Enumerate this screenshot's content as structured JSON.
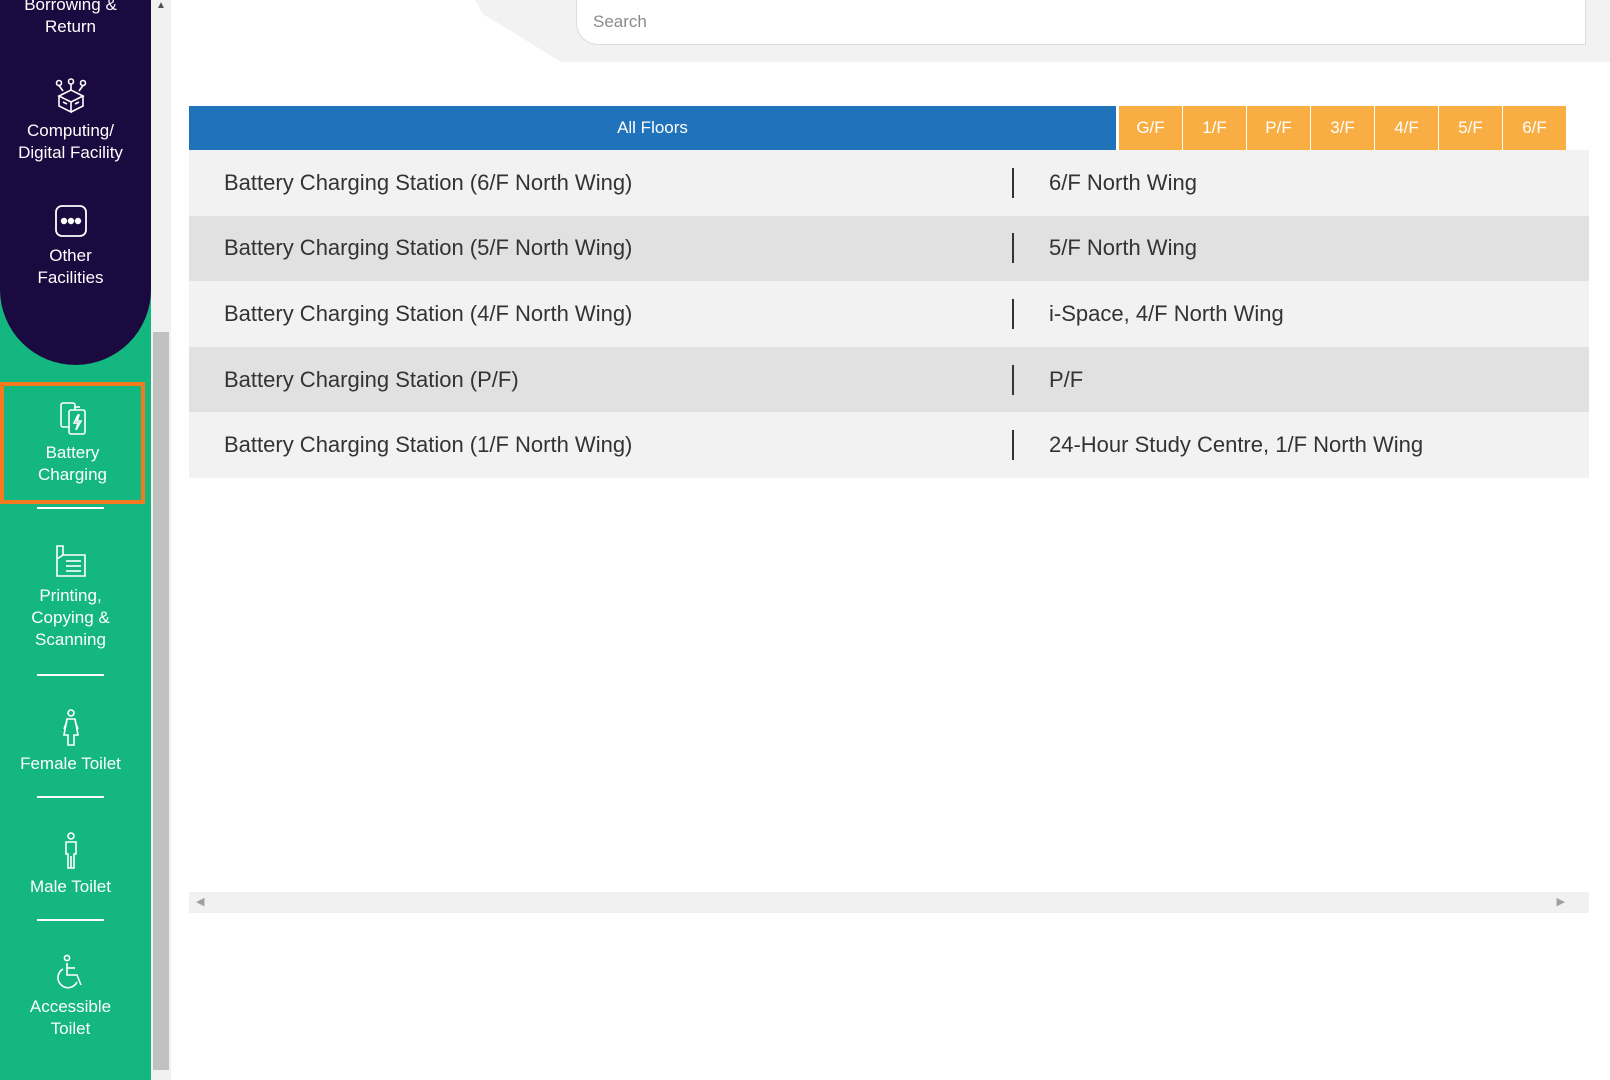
{
  "sidebar": {
    "items": [
      {
        "label": "Borrowing &\nReturn",
        "icon": "book-return-icon"
      },
      {
        "label": "Computing/\nDigital Facility",
        "icon": "computer-network-icon"
      },
      {
        "label": "Other\nFacilities",
        "icon": "more-dots-icon"
      },
      {
        "label": "Battery\nCharging",
        "icon": "battery-charging-icon",
        "selected": true
      },
      {
        "label": "Printing,\nCopying &\nScanning",
        "icon": "printer-icon"
      },
      {
        "label": "Female Toilet",
        "icon": "female-icon"
      },
      {
        "label": "Male Toilet",
        "icon": "male-icon"
      },
      {
        "label": "Accessible\nToilet",
        "icon": "wheelchair-icon"
      }
    ]
  },
  "search": {
    "placeholder": "Search",
    "value": ""
  },
  "floor_tabs": {
    "all": "All Floors",
    "floors": [
      "G/F",
      "1/F",
      "P/F",
      "3/F",
      "4/F",
      "5/F",
      "6/F"
    ]
  },
  "table": {
    "rows": [
      {
        "name": "Battery Charging Station (6/F North Wing)",
        "location": "6/F North Wing"
      },
      {
        "name": "Battery Charging Station (5/F North Wing)",
        "location": "5/F North Wing"
      },
      {
        "name": "Battery Charging Station (4/F North Wing)",
        "location": "i-Space, 4/F North Wing"
      },
      {
        "name": "Battery Charging Station (P/F)",
        "location": "P/F"
      },
      {
        "name": "Battery Charging Station (1/F North Wing)",
        "location": "24-Hour Study Centre, 1/F North Wing"
      }
    ]
  },
  "colors": {
    "sidebar_green": "#13b77f",
    "sidebar_navy": "#1a0a3f",
    "selected_border": "#f47a20",
    "all_floors_blue": "#2073ba",
    "floor_tab_orange": "#f9ae43"
  }
}
